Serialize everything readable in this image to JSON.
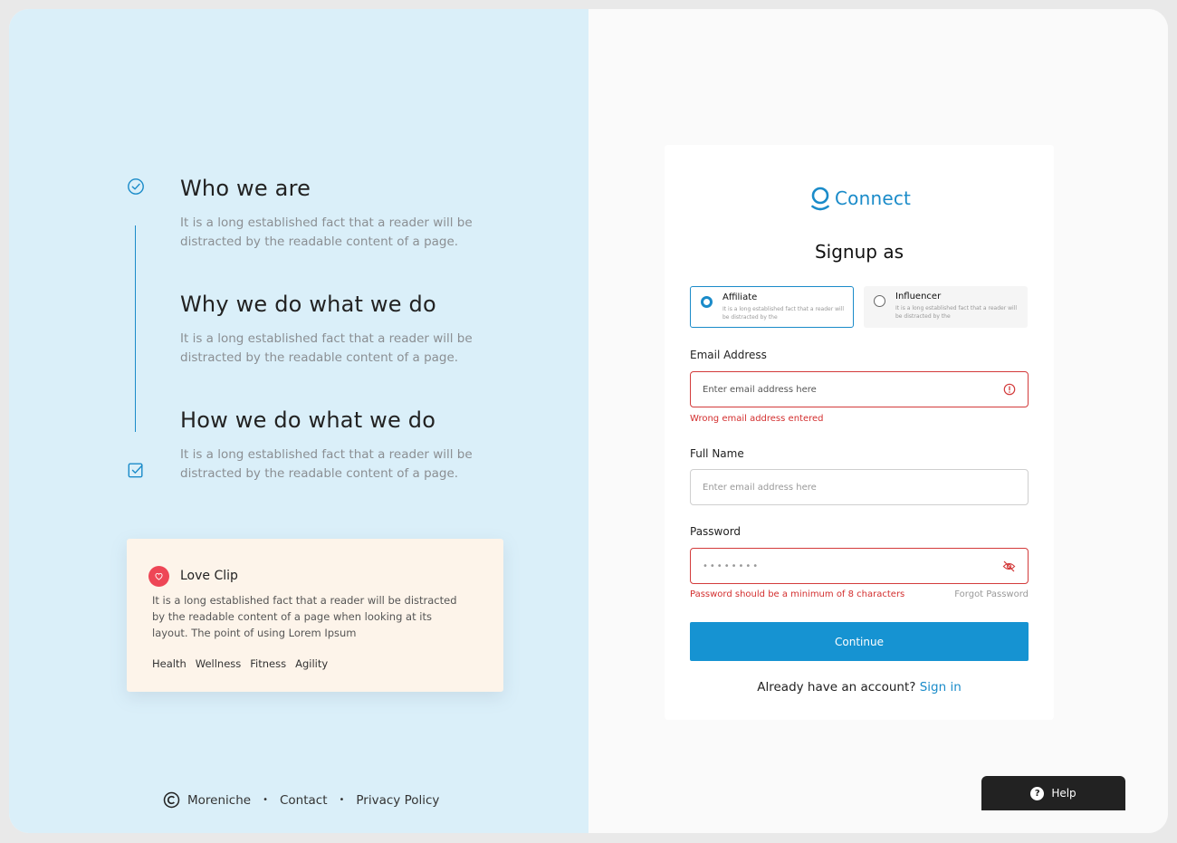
{
  "left_panel": {
    "sections": [
      {
        "heading": "Who we are",
        "text": "It is a long established fact that a reader will be distracted by the readable content of a page."
      },
      {
        "heading": "Why we do what we do",
        "text": "It is a long established fact that a reader will be distracted by the readable content of a page."
      },
      {
        "heading": "How we do what we do",
        "text": "It is a long established fact that a reader will be distracted by the readable content of a page."
      }
    ],
    "card": {
      "title": "Love Clip",
      "text": "It is a long established fact that a reader will be distracted by the readable content of a page when looking at its layout. The point of using Lorem Ipsum",
      "tags": [
        "Health",
        "Wellness",
        "Fitness",
        "Agility"
      ]
    },
    "footer": {
      "brand": "Moreniche",
      "links": [
        "Contact",
        "Privacy Policy"
      ],
      "separator": "•"
    }
  },
  "form": {
    "brand": "Connect",
    "title": "Signup as",
    "options": [
      {
        "title": "Affiliate",
        "desc": "It is a long established fact that a reader will be distracted by the",
        "selected": true
      },
      {
        "title": "Influencer",
        "desc": "It is a long established fact that a reader will be distracted by the",
        "selected": false
      }
    ],
    "email": {
      "label": "Email Address",
      "placeholder": "Enter email address here",
      "error": "Wrong email address entered"
    },
    "name": {
      "label": "Full Name",
      "placeholder": "Enter email address here"
    },
    "password": {
      "label": "Password",
      "value": "••••••••",
      "error": "Password should be a minimum of 8 characters",
      "forgot": "Forgot Password"
    },
    "submit_label": "Continue",
    "signin_prompt": "Already have an account?",
    "signin_link": "Sign in"
  },
  "help": {
    "label": "Help",
    "icon": "?"
  },
  "colors": {
    "accent": "#1a8bc9",
    "error": "#d32f2f",
    "left_bg": "#daeff9",
    "card_bg": "#fdf4ea",
    "brand_red": "#ee4656"
  }
}
